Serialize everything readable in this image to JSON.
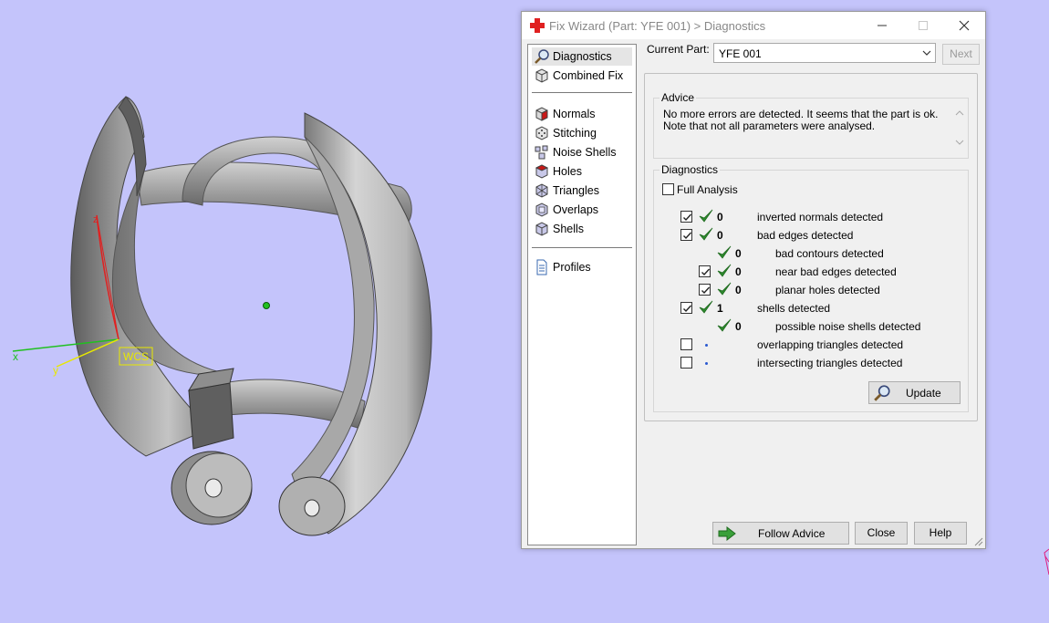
{
  "window": {
    "title": "Fix Wizard (Part: YFE 001) > Diagnostics",
    "app_icon": "red-cross-icon"
  },
  "nav": {
    "items": [
      {
        "label": "Diagnostics",
        "icon": "magnifier-icon",
        "selected": true
      },
      {
        "label": "Combined Fix",
        "icon": "cube-icon"
      },
      {
        "label": "Normals",
        "icon": "cube-red-face-icon"
      },
      {
        "label": "Stitching",
        "icon": "cube-dots-icon"
      },
      {
        "label": "Noise Shells",
        "icon": "noise-shells-icon"
      },
      {
        "label": "Holes",
        "icon": "cube-hole-icon"
      },
      {
        "label": "Triangles",
        "icon": "triangles-icon"
      },
      {
        "label": "Overlaps",
        "icon": "overlaps-icon"
      },
      {
        "label": "Shells",
        "icon": "shells-icon"
      },
      {
        "label": "Profiles",
        "icon": "document-icon"
      }
    ]
  },
  "current_part": {
    "label": "Current Part:",
    "value": "YFE 001"
  },
  "next_button": "Next",
  "advice": {
    "legend": "Advice",
    "text": "No more errors are detected. It seems that the part is ok. Note that not all parameters were analysed."
  },
  "diagnostics": {
    "legend": "Diagnostics",
    "full_analysis_label": "Full Analysis",
    "full_analysis_checked": false,
    "rows": [
      {
        "checkbox": true,
        "checked": true,
        "status": "check",
        "count": "0",
        "label": "inverted normals detected"
      },
      {
        "checkbox": true,
        "checked": true,
        "status": "check",
        "count": "0",
        "label": "bad edges detected"
      },
      {
        "checkbox": false,
        "status": "check",
        "count": "0",
        "label": "bad contours detected"
      },
      {
        "checkbox": true,
        "checked": true,
        "status": "check",
        "count": "0",
        "label": "near bad edges detected"
      },
      {
        "checkbox": true,
        "checked": true,
        "status": "check",
        "count": "0",
        "label": "planar holes detected"
      },
      {
        "checkbox": true,
        "checked": true,
        "status": "check",
        "count": "1",
        "label": "shells detected"
      },
      {
        "checkbox": false,
        "status": "check",
        "count": "0",
        "label": "possible noise shells detected"
      },
      {
        "checkbox": true,
        "checked": false,
        "status": "dot",
        "count": "",
        "label": "overlapping triangles detected"
      },
      {
        "checkbox": true,
        "checked": false,
        "status": "dot",
        "count": "",
        "label": "intersecting triangles detected"
      }
    ],
    "update_button": "Update"
  },
  "footer": {
    "follow_advice": "Follow Advice",
    "close": "Close",
    "help": "Help"
  },
  "viewport": {
    "wcs_label": "WCS",
    "axis_x": "x",
    "axis_y": "y",
    "axis_z": "z",
    "background": "#c4c4fb",
    "model_color": "#9a9a9a"
  },
  "colors": {
    "check_green": "#2e8a2e",
    "dot_blue": "#2a5ad0",
    "app_icon_red": "#e02020"
  }
}
